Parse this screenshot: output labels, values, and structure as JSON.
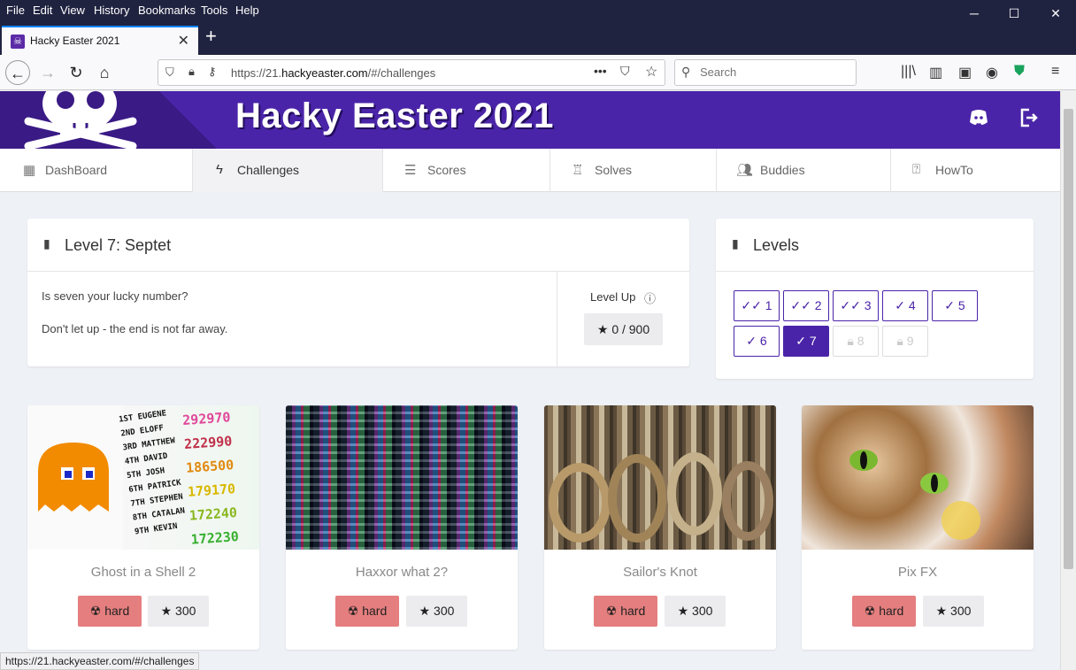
{
  "menubar": {
    "items": [
      "File",
      "Edit",
      "View",
      "History",
      "Bookmarks",
      "Tools",
      "Help"
    ]
  },
  "window": {
    "minimize": "─",
    "maximize": "☐",
    "close": "✕"
  },
  "tab": {
    "title": "Hacky Easter 2021",
    "close": "✕",
    "new_tab": "+"
  },
  "navbar": {
    "url_prefix": "https://21.",
    "url_domain": "hackyeaster.com",
    "url_suffix": "/#/challenges",
    "search_placeholder": "Search"
  },
  "site": {
    "title": "Hacky Easter 2021",
    "nav": [
      {
        "label": "DashBoard",
        "icon": "dashboard-icon"
      },
      {
        "label": "Challenges",
        "icon": "bolt-icon"
      },
      {
        "label": "Scores",
        "icon": "list-icon"
      },
      {
        "label": "Solves",
        "icon": "trophy-icon"
      },
      {
        "label": "Buddies",
        "icon": "users-icon"
      },
      {
        "label": "HowTo",
        "icon": "help-icon"
      }
    ]
  },
  "level_card": {
    "title": "Level 7: Septet",
    "line1": "Is seven your lucky number?",
    "line2": "Don't let up - the end is not far away.",
    "level_up_label": "Level Up",
    "level_up_info": "ⓘ",
    "progress_text": "0 / 900",
    "progress_fraction": 0
  },
  "levels_card": {
    "title": "Levels",
    "levels": [
      {
        "label": "1",
        "state": "done"
      },
      {
        "label": "2",
        "state": "done"
      },
      {
        "label": "3",
        "state": "done"
      },
      {
        "label": "4",
        "state": "done"
      },
      {
        "label": "5",
        "state": "done"
      },
      {
        "label": "6",
        "state": "done"
      },
      {
        "label": "7",
        "state": "current"
      },
      {
        "label": "8",
        "state": "locked"
      },
      {
        "label": "9",
        "state": "locked"
      }
    ]
  },
  "challenges": [
    {
      "title": "Ghost in a Shell 2",
      "difficulty": "hard",
      "points": "300"
    },
    {
      "title": "Haxxor what 2?",
      "difficulty": "hard",
      "points": "300"
    },
    {
      "title": "Sailor's Knot",
      "difficulty": "hard",
      "points": "300"
    },
    {
      "title": "Pix FX",
      "difficulty": "hard",
      "points": "300"
    }
  ],
  "pacman_scores": [
    {
      "name": "1ST EUGENE",
      "score": "292970"
    },
    {
      "name": "2ND ELOFF",
      "score": "222990"
    },
    {
      "name": "3RD MATTHEW",
      "score": "186500"
    },
    {
      "name": "4TH DAVID",
      "score": "179170"
    },
    {
      "name": "5TH JOSH",
      "score": "172240"
    },
    {
      "name": "6TH PATRICK",
      "score": "172230"
    },
    {
      "name": "7TH STEPHEN",
      "score": ""
    },
    {
      "name": "8TH CATALAN",
      "score": ""
    },
    {
      "name": "9TH KEVIN",
      "score": ""
    }
  ],
  "statusbar": "https://21.hackyeaster.com/#/challenges",
  "colors": {
    "brand": "#4a24a8",
    "hard": "#e57e7e"
  }
}
